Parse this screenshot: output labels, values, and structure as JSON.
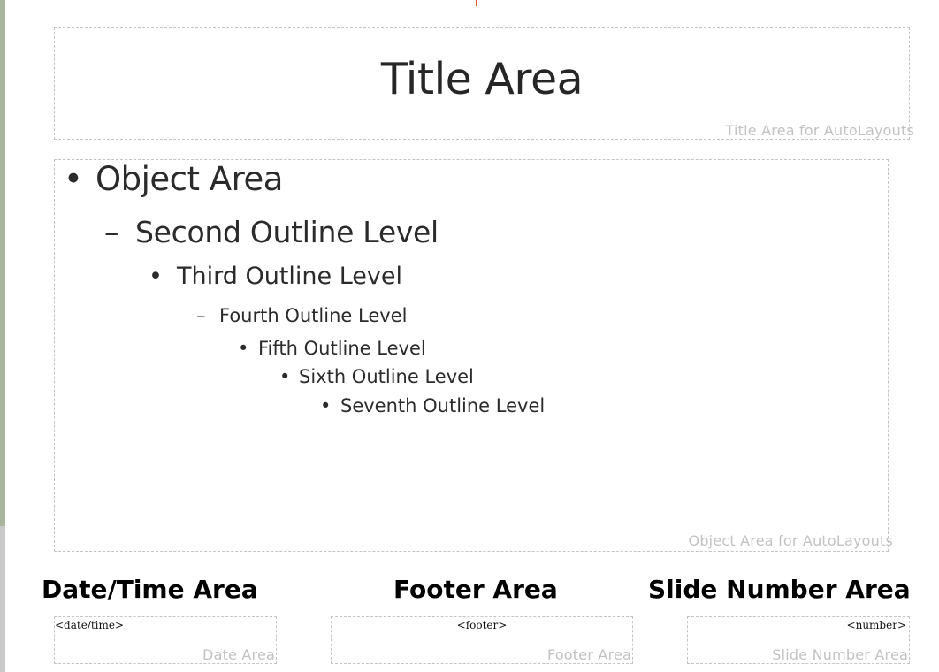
{
  "slide": {
    "title_area": {
      "title": "Title Area",
      "placeholder_label": "Title Area for AutoLayouts"
    },
    "object_area": {
      "placeholder_label": "Object Area for AutoLayouts",
      "outline_levels": [
        {
          "bullet": "•",
          "text": "Object Area"
        },
        {
          "bullet": "–",
          "text": "Second Outline Level"
        },
        {
          "bullet": "•",
          "text": "Third Outline Level"
        },
        {
          "bullet": "–",
          "text": "Fourth Outline Level"
        },
        {
          "bullet": "•",
          "text": "Fifth Outline Level"
        },
        {
          "bullet": "•",
          "text": "Sixth Outline Level"
        },
        {
          "bullet": "•",
          "text": "Seventh Outline Level"
        }
      ]
    },
    "date_area": {
      "heading": "Date/Time Area",
      "field": "<date/time>",
      "placeholder_label": "Date Area"
    },
    "footer_area": {
      "heading": "Footer Area",
      "field": "<footer>",
      "placeholder_label": "Footer Area"
    },
    "slide_number_area": {
      "heading": "Slide Number Area",
      "field": "<number>",
      "placeholder_label": "Slide Number Area"
    }
  },
  "colors": {
    "border_dashed": "#c4c4c4",
    "placeholder_label": "#c2c2c2",
    "left_edge": "#a9b59c",
    "cursor_mark": "#e05a2b"
  }
}
